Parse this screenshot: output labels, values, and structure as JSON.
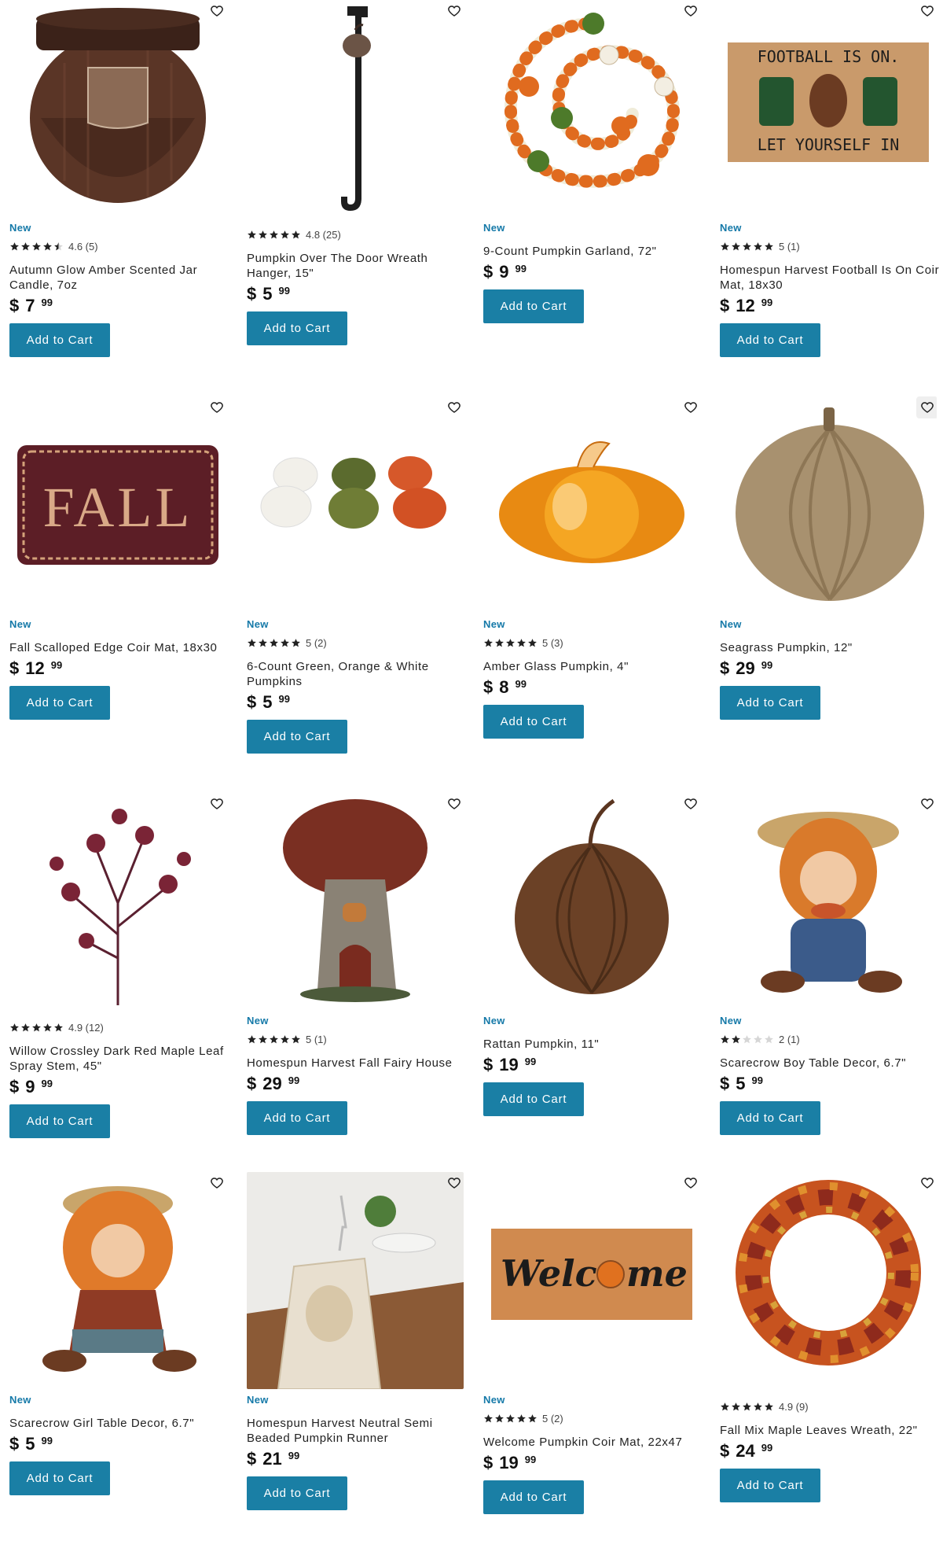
{
  "labels": {
    "new_badge": "New",
    "add_to_cart": "Add to Cart",
    "currency": "$"
  },
  "colors": {
    "accent": "#1a7fa5",
    "badge": "#1579a8",
    "star": "#222222",
    "star_empty": "#d6d6d6"
  },
  "icons": {
    "wishlist": "heart-outline-icon",
    "rating": "star-icon"
  },
  "products": [
    {
      "badge": "New",
      "stars": 4.5,
      "rating_text": "4.6 (5)",
      "title": "Autumn Glow Amber Scented Jar Candle, 7oz",
      "dollars": "7",
      "cents": "99",
      "image": "amber-candle"
    },
    {
      "badge": "",
      "stars": 5,
      "rating_text": "4.8 (25)",
      "title": "Pumpkin Over The Door Wreath Hanger, 15\"",
      "dollars": "5",
      "cents": "99",
      "image": "wreath-hanger"
    },
    {
      "badge": "New",
      "stars": 0,
      "rating_text": "",
      "title": "9-Count Pumpkin Garland, 72\"",
      "dollars": "9",
      "cents": "99",
      "image": "pumpkin-garland"
    },
    {
      "badge": "New",
      "stars": 5,
      "rating_text": "5 (1)",
      "title": "Homespun Harvest Football Is On Coir Mat, 18x30",
      "dollars": "12",
      "cents": "99",
      "image": "football-mat",
      "mat_top": "FOOTBALL IS ON.",
      "mat_bottom": "LET YOURSELF IN"
    },
    {
      "badge": "New",
      "stars": 0,
      "rating_text": "",
      "title": "Fall Scalloped Edge Coir Mat, 18x30",
      "dollars": "12",
      "cents": "99",
      "image": "fall-mat",
      "mat_text": "FALL"
    },
    {
      "badge": "New",
      "stars": 5,
      "rating_text": "5 (2)",
      "title": "6-Count Green, Orange & White Pumpkins",
      "dollars": "5",
      "cents": "99",
      "image": "mini-pumpkins"
    },
    {
      "badge": "New",
      "stars": 5,
      "rating_text": "5 (3)",
      "title": "Amber Glass Pumpkin, 4\"",
      "dollars": "8",
      "cents": "99",
      "image": "glass-pumpkin"
    },
    {
      "badge": "New",
      "stars": 0,
      "rating_text": "",
      "title": "Seagrass Pumpkin, 12\"",
      "dollars": "29",
      "cents": "99",
      "image": "seagrass-pumpkin"
    },
    {
      "badge": "",
      "stars": 5,
      "rating_text": "4.9 (12)",
      "title": "Willow Crossley Dark Red Maple Leaf Spray Stem, 45\"",
      "dollars": "9",
      "cents": "99",
      "image": "maple-stem"
    },
    {
      "badge": "New",
      "stars": 5,
      "rating_text": "5 (1)",
      "title": "Homespun Harvest Fall Fairy House",
      "dollars": "29",
      "cents": "99",
      "image": "fairy-house"
    },
    {
      "badge": "New",
      "stars": 0,
      "rating_text": "",
      "title": "Rattan Pumpkin, 11\"",
      "dollars": "19",
      "cents": "99",
      "image": "rattan-pumpkin"
    },
    {
      "badge": "New",
      "stars": 2,
      "rating_text": "2 (1)",
      "title": "Scarecrow Boy Table Decor, 6.7\"",
      "dollars": "5",
      "cents": "99",
      "image": "scarecrow-boy"
    },
    {
      "badge": "New",
      "stars": 0,
      "rating_text": "",
      "title": "Scarecrow Girl Table Decor, 6.7\"",
      "dollars": "5",
      "cents": "99",
      "image": "scarecrow-girl"
    },
    {
      "badge": "New",
      "stars": 0,
      "rating_text": "",
      "title": "Homespun Harvest Neutral Semi Beaded Pumpkin Runner",
      "dollars": "21",
      "cents": "99",
      "image": "table-runner"
    },
    {
      "badge": "New",
      "stars": 5,
      "rating_text": "5 (2)",
      "title": "Welcome Pumpkin Coir Mat, 22x47",
      "dollars": "19",
      "cents": "99",
      "image": "welcome-mat",
      "mat_text_a": "Welc",
      "mat_text_b": "me"
    },
    {
      "badge": "",
      "stars": 5,
      "rating_text": "4.9 (9)",
      "title": "Fall Mix Maple Leaves Wreath, 22\"",
      "dollars": "24",
      "cents": "99",
      "image": "leaves-wreath"
    }
  ]
}
